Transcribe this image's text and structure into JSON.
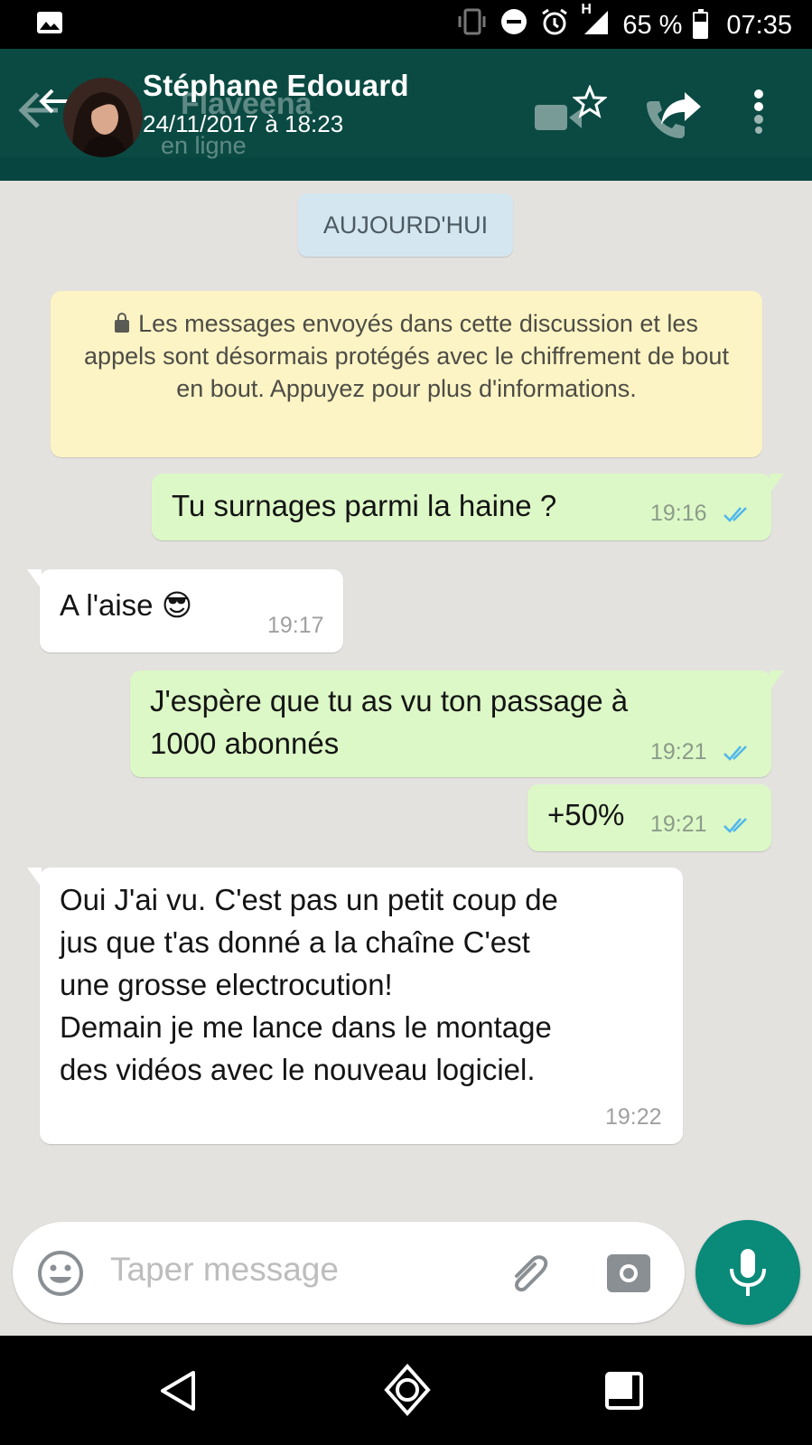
{
  "status_bar": {
    "battery_percent": "65 %",
    "battery_level": 0.65,
    "time": "07:35",
    "network": "H",
    "icons": [
      "image-icon",
      "vibrate-icon",
      "do-not-disturb-icon",
      "alarm-icon",
      "signal-icon",
      "battery-icon"
    ]
  },
  "header": {
    "title": "Stéphane Edouard",
    "subtitle": "24/11/2017 à 18:23",
    "ghost_name": "Flaveena",
    "ghost_status": "en ligne",
    "icons": [
      "back-arrow-icon",
      "avatar",
      "video-call-icon",
      "star-icon",
      "call-icon",
      "share-icon",
      "more-icon"
    ]
  },
  "chat": {
    "date_chip": "AUJOURD'HUI",
    "notice": "Les messages envoyés dans cette discussion et les appels sont désormais protégés avec le chiffrement de bout en bout. Appuyez pour plus d'informations.",
    "messages": [
      {
        "direction": "out",
        "text": "Tu surnages parmi la haine ?",
        "time": "19:16",
        "read": true
      },
      {
        "direction": "in",
        "text": "A l'aise 😎",
        "time": "19:17"
      },
      {
        "direction": "out",
        "text": "J'espère que tu as vu ton passage à 1000 abonnés",
        "line1": "J'espère que tu as vu ton passage à",
        "line2": "1000 abonnés",
        "time": "19:21",
        "read": true
      },
      {
        "direction": "out",
        "text": "+50%",
        "time": "19:21",
        "read": true
      },
      {
        "direction": "in",
        "lines": [
          "Oui J'ai vu. C'est pas un petit coup de",
          "jus que t'as donné a la chaîne C'est",
          "une grosse electrocution!",
          "Demain je me lance dans le montage",
          "des vidéos avec le nouveau logiciel."
        ],
        "time": "19:22"
      }
    ]
  },
  "input": {
    "placeholder": "Taper message"
  },
  "colors": {
    "header": "#0a4a43",
    "outgoing_bubble": "#dcf8c6",
    "incoming_bubble": "#ffffff",
    "mic_button": "#0a8a79",
    "ticks": "#4fb6ec",
    "chat_background": "#e4e2df"
  }
}
